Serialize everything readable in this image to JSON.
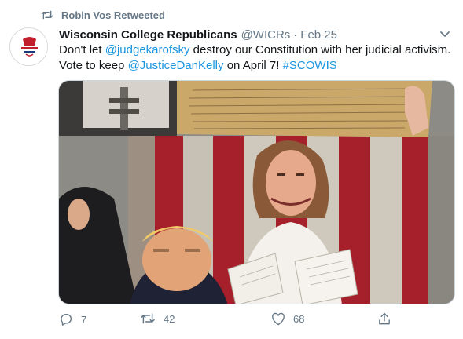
{
  "retweet_banner": {
    "text": "Robin Vos Retweeted",
    "icon": "retweet-icon"
  },
  "tweet": {
    "author_name": "Wisconsin College Republicans",
    "handle": "@WICRs",
    "separator": "·",
    "date": "Feb 25",
    "text_parts": {
      "p1": "Don't let ",
      "mention1": "@judgekarofsky",
      "p2": " destroy our Constitution with her judicial activism. Vote to keep ",
      "mention2": "@JusticeDanKelly",
      "p3": " on April 7! ",
      "hashtag": "#SCOWIS"
    },
    "avatar_text": "COLLEGE REPUBLICANS"
  },
  "actions": {
    "reply_count": "7",
    "retweet_count": "42",
    "like_count": "68"
  },
  "colors": {
    "link": "#1b95e0",
    "muted": "#657786",
    "text": "#14171a",
    "border": "#ccd6dd"
  }
}
